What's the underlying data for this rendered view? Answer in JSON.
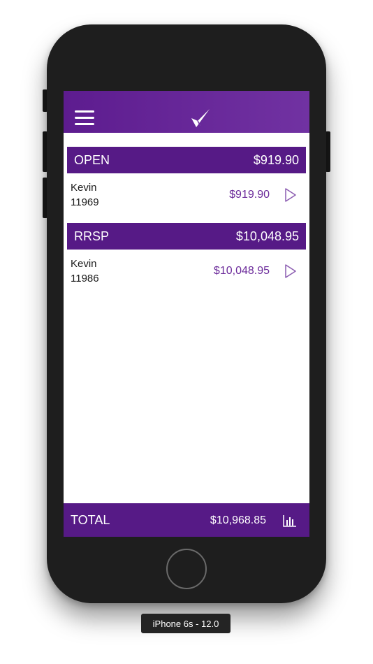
{
  "navbar": {
    "menu_icon": "hamburger-menu-icon",
    "logo_icon": "checkmark-logo-icon"
  },
  "sections": [
    {
      "title": "OPEN",
      "total": "$919.90",
      "accounts": [
        {
          "name": "Kevin",
          "number": "11969",
          "amount": "$919.90"
        }
      ]
    },
    {
      "title": "RRSP",
      "total": "$10,048.95",
      "accounts": [
        {
          "name": "Kevin",
          "number": "11986",
          "amount": "$10,048.95"
        }
      ]
    }
  ],
  "footer": {
    "label": "TOTAL",
    "total": "$10,968.85",
    "chart_icon": "bar-chart-icon"
  },
  "simulator_label": "iPhone 6s - 12.0",
  "colors": {
    "nav": "#6a2a9c",
    "section": "#561a86",
    "amount": "#6b2a9a",
    "phone": "#1e1e1e"
  }
}
